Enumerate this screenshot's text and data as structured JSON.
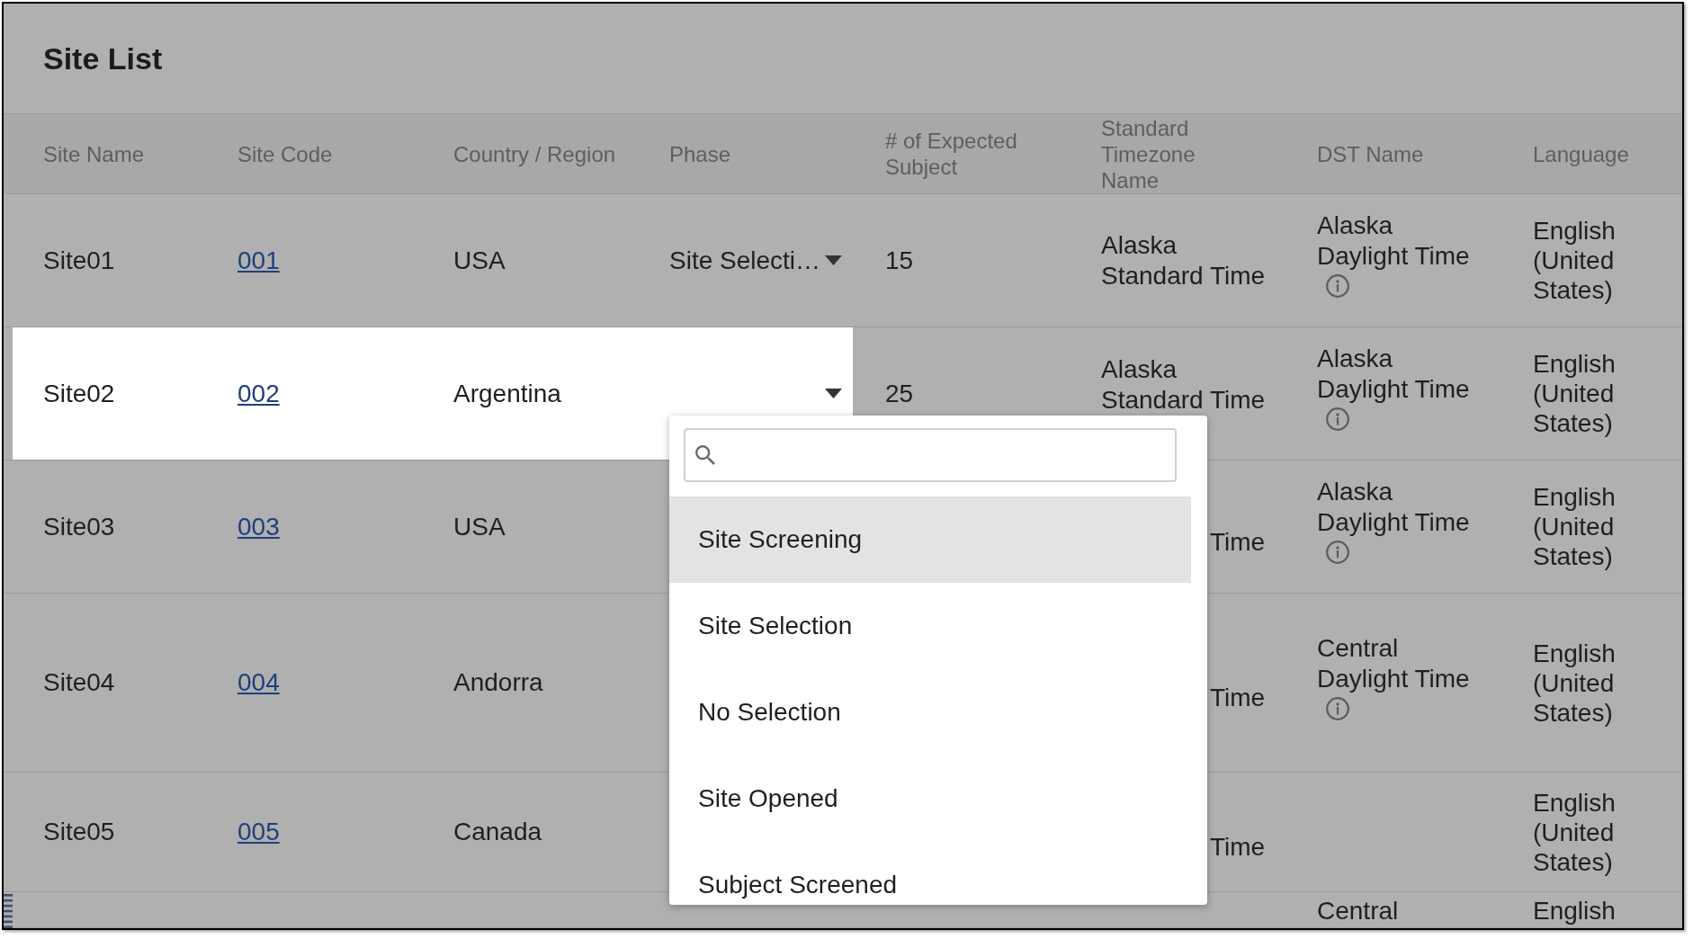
{
  "title": "Site List",
  "table": {
    "columns": [
      "Site Name",
      "Site Code",
      "Country / Region",
      "Phase",
      "# of Expected Subject",
      "Standard Timezone Name",
      "DST Name",
      "Language"
    ],
    "rows": [
      {
        "selected": false,
        "site_name": "Site01",
        "site_code": "001",
        "country_region": "USA",
        "phase": "Site Selecti…",
        "phase_expanded": false,
        "expected_subjects": "15",
        "standard_timezone": "Alaska Standard Time",
        "dst_name": "Alaska Daylight Time",
        "dst_info": true,
        "language": "English (United States)"
      },
      {
        "selected": true,
        "site_name": "Site02",
        "site_code": "002",
        "country_region": "Argentina",
        "phase_expanded": true,
        "expected_subjects": "25",
        "standard_timezone": "Alaska Standard Time",
        "dst_name": "Alaska Daylight Time",
        "dst_info": true,
        "language": "English (United States)"
      },
      {
        "selected": false,
        "site_name": "Site03",
        "site_code": "003",
        "country_region": "USA",
        "standard_timezone": "Time",
        "dst_name": "Alaska Daylight Time",
        "dst_info": true,
        "language": "English (United States)"
      },
      {
        "selected": false,
        "site_name": "Site04",
        "site_code": "004",
        "country_region": "Andorra",
        "standard_timezone": "Time",
        "dst_name": "Central Daylight Time",
        "dst_info": true,
        "language": "English (United States)"
      },
      {
        "selected": false,
        "site_name": "Site05",
        "site_code": "005",
        "country_region": "Canada",
        "standard_timezone": "Time",
        "dst_info": false,
        "language": "English (United States)"
      },
      {
        "selected": false,
        "dst_name": "Central",
        "dst_info": false,
        "language": "English"
      }
    ]
  },
  "phase_dropdown": {
    "options": [
      {
        "label": "Site Screening",
        "selected": true
      },
      {
        "label": "Site Selection",
        "selected": false
      },
      {
        "label": "No Selection",
        "selected": false
      },
      {
        "label": "Site Opened",
        "selected": false
      },
      {
        "label": "Subject Screened",
        "selected": false
      }
    ]
  }
}
